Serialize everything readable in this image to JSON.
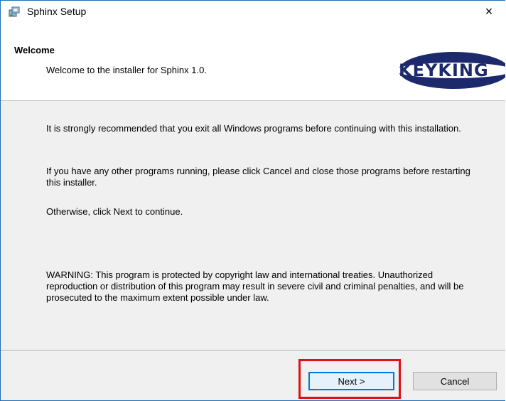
{
  "window": {
    "title": "Sphinx Setup",
    "close_glyph": "×"
  },
  "header": {
    "title": "Welcome",
    "subtitle": "Welcome to the installer for Sphinx 1.0.",
    "logo_text": "KEYKING"
  },
  "content": {
    "paragraph1": "It is strongly recommended that you exit all Windows programs before continuing with this installation.",
    "paragraph2": "If you have any other programs running, please click Cancel and close those programs before restarting this installer.",
    "paragraph3": "Otherwise, click Next to continue.",
    "warning": "WARNING: This program is protected by copyright law and international treaties. Unauthorized reproduction or distribution of this program may result in severe civil and criminal penalties, and will be prosecuted to the maximum extent possible under law."
  },
  "buttons": {
    "next_label": "Next >",
    "cancel_label": "Cancel"
  },
  "colors": {
    "highlight": "#e0101a",
    "accent": "#0078d7",
    "logo_navy": "#1c2a6b"
  },
  "icons": {
    "app": "installer-package-icon",
    "close": "close-icon"
  }
}
